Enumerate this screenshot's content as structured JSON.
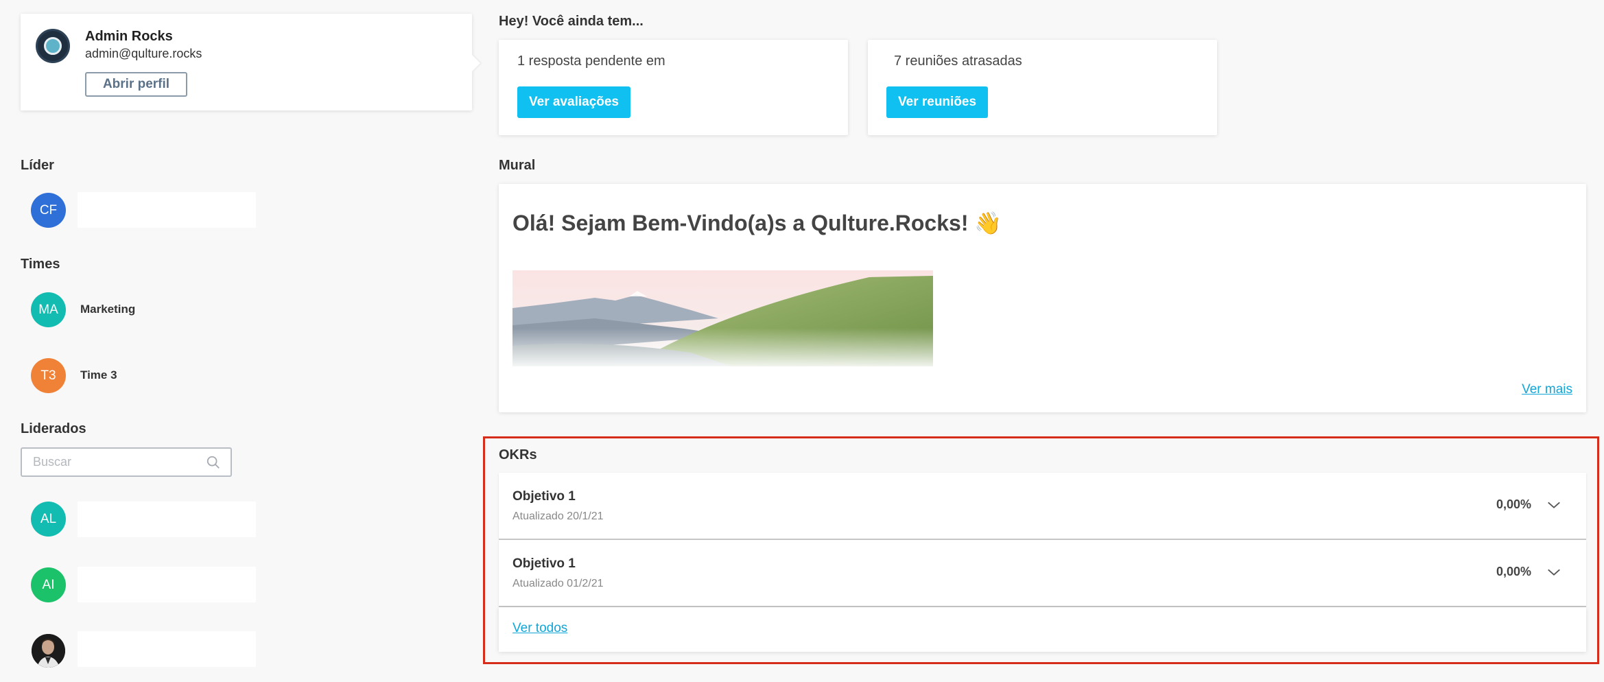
{
  "profile": {
    "name": "Admin Rocks",
    "email": "admin@qulture.rocks",
    "open_profile_label": "Abrir perfil"
  },
  "leader": {
    "title": "Líder",
    "initials": "CF",
    "color": "#2f6fd8"
  },
  "teams": {
    "title": "Times",
    "items": [
      {
        "initials": "MA",
        "name": "Marketing",
        "color": "#13bcb1"
      },
      {
        "initials": "T3",
        "name": "Time 3",
        "color": "#f08237"
      }
    ]
  },
  "led": {
    "title": "Liderados",
    "search_placeholder": "Buscar",
    "items": [
      {
        "initials": "AL",
        "color": "#13bcb1"
      },
      {
        "initials": "AI",
        "color": "#1cc26a"
      }
    ]
  },
  "pending": {
    "title": "Hey! Você ainda tem...",
    "cards": [
      {
        "text": "1 resposta pendente em",
        "button": "Ver avaliações"
      },
      {
        "text": "7 reuniões atrasadas",
        "button": "Ver reuniões"
      }
    ]
  },
  "mural": {
    "title": "Mural",
    "heading": "Olá! Sejam Bem-Vindo(a)s a Qulture.Rocks! 👋",
    "see_more": "Ver mais"
  },
  "okrs": {
    "title": "OKRs",
    "items": [
      {
        "name": "Objetivo 1",
        "updated": "Atualizado 20/1/21",
        "progress": "0,00%"
      },
      {
        "name": "Objetivo 1",
        "updated": "Atualizado 01/2/21",
        "progress": "0,00%"
      }
    ],
    "see_all": "Ver todos"
  },
  "colors": {
    "accent": "#10c0f0",
    "link": "#10a6d8",
    "highlight": "#d62c1a"
  }
}
